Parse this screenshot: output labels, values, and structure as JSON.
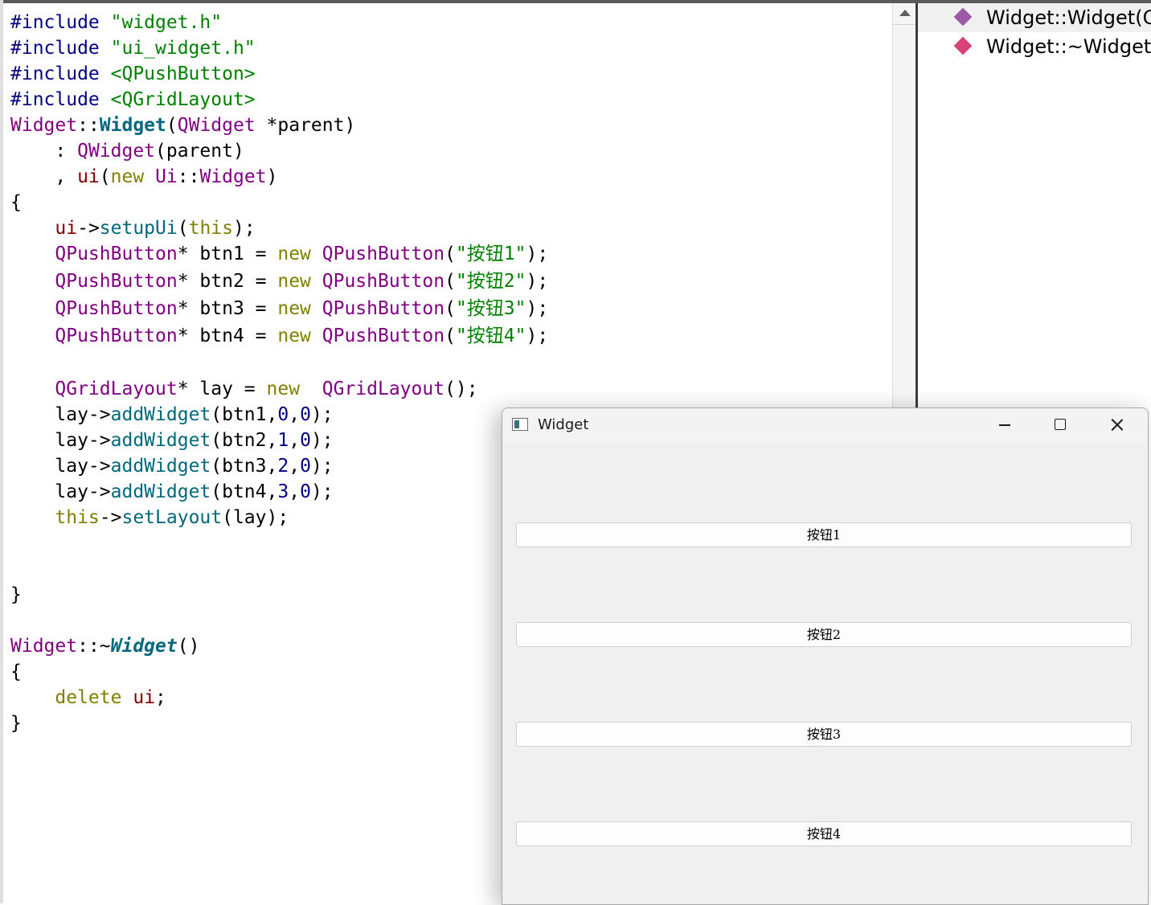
{
  "editor": {
    "lines": [
      [
        [
          "#include ",
          "t-pre"
        ],
        [
          "\"widget.h\"",
          "t-str"
        ]
      ],
      [
        [
          "#include ",
          "t-pre"
        ],
        [
          "\"ui_widget.h\"",
          "t-str"
        ]
      ],
      [
        [
          "#include ",
          "t-pre"
        ],
        [
          "<QPushButton>",
          "t-str"
        ]
      ],
      [
        [
          "#include ",
          "t-pre"
        ],
        [
          "<QGridLayout>",
          "t-str"
        ]
      ],
      [
        [
          "Widget",
          "t-type"
        ],
        [
          "::",
          ""
        ],
        [
          "Widget",
          "t-fn t-bold"
        ],
        [
          "(",
          ""
        ],
        [
          "QWidget",
          "t-type"
        ],
        [
          " *parent)",
          ""
        ]
      ],
      [
        [
          "    : ",
          ""
        ],
        [
          "QWidget",
          "t-type"
        ],
        [
          "(parent)",
          ""
        ]
      ],
      [
        [
          "    , ",
          ""
        ],
        [
          "ui",
          "t-var"
        ],
        [
          "(",
          ""
        ],
        [
          "new",
          "t-kw"
        ],
        [
          " ",
          ""
        ],
        [
          "Ui",
          "t-type"
        ],
        [
          "::",
          ""
        ],
        [
          "Widget",
          "t-type"
        ],
        [
          ")",
          ""
        ]
      ],
      [
        [
          "{",
          ""
        ]
      ],
      [
        [
          "    ",
          ""
        ],
        [
          "ui",
          "t-var"
        ],
        [
          "->",
          ""
        ],
        [
          "setupUi",
          "t-fn"
        ],
        [
          "(",
          ""
        ],
        [
          "this",
          "t-kw"
        ],
        [
          ");",
          ""
        ]
      ],
      [
        [
          "    ",
          ""
        ],
        [
          "QPushButton",
          "t-type"
        ],
        [
          "* btn1 = ",
          ""
        ],
        [
          "new",
          "t-kw"
        ],
        [
          " ",
          ""
        ],
        [
          "QPushButton",
          "t-type"
        ],
        [
          "(",
          ""
        ],
        [
          "\"按钮1\"",
          "t-str"
        ],
        [
          ");",
          ""
        ]
      ],
      [
        [
          "    ",
          ""
        ],
        [
          "QPushButton",
          "t-type"
        ],
        [
          "* btn2 = ",
          ""
        ],
        [
          "new",
          "t-kw"
        ],
        [
          " ",
          ""
        ],
        [
          "QPushButton",
          "t-type"
        ],
        [
          "(",
          ""
        ],
        [
          "\"按钮2\"",
          "t-str"
        ],
        [
          ");",
          ""
        ]
      ],
      [
        [
          "    ",
          ""
        ],
        [
          "QPushButton",
          "t-type"
        ],
        [
          "* btn3 = ",
          ""
        ],
        [
          "new",
          "t-kw"
        ],
        [
          " ",
          ""
        ],
        [
          "QPushButton",
          "t-type"
        ],
        [
          "(",
          ""
        ],
        [
          "\"按钮3\"",
          "t-str"
        ],
        [
          ");",
          ""
        ]
      ],
      [
        [
          "    ",
          ""
        ],
        [
          "QPushButton",
          "t-type"
        ],
        [
          "* btn4 = ",
          ""
        ],
        [
          "new",
          "t-kw"
        ],
        [
          " ",
          ""
        ],
        [
          "QPushButton",
          "t-type"
        ],
        [
          "(",
          ""
        ],
        [
          "\"按钮4\"",
          "t-str"
        ],
        [
          ");",
          ""
        ]
      ],
      [
        [
          "    ",
          ""
        ],
        [
          "QGridLayout",
          "t-type"
        ],
        [
          "* lay = ",
          ""
        ],
        [
          "new",
          "t-kw"
        ],
        [
          "  ",
          ""
        ],
        [
          "QGridLayout",
          "t-type"
        ],
        [
          "();",
          ""
        ]
      ],
      [
        [
          "    ",
          ""
        ],
        [
          "lay->",
          ""
        ],
        [
          "addWidget",
          "t-fn"
        ],
        [
          "(btn1,",
          ""
        ],
        [
          "0",
          "t-num"
        ],
        [
          ",",
          ""
        ],
        [
          "0",
          "t-num"
        ],
        [
          ");",
          ""
        ]
      ],
      [
        [
          "    ",
          ""
        ],
        [
          "lay->",
          ""
        ],
        [
          "addWidget",
          "t-fn"
        ],
        [
          "(btn2,",
          ""
        ],
        [
          "1",
          "t-num"
        ],
        [
          ",",
          ""
        ],
        [
          "0",
          "t-num"
        ],
        [
          ");",
          ""
        ]
      ],
      [
        [
          "    ",
          ""
        ],
        [
          "lay->",
          ""
        ],
        [
          "addWidget",
          "t-fn"
        ],
        [
          "(btn3,",
          ""
        ],
        [
          "2",
          "t-num"
        ],
        [
          ",",
          ""
        ],
        [
          "0",
          "t-num"
        ],
        [
          ");",
          ""
        ]
      ],
      [
        [
          "    ",
          ""
        ],
        [
          "lay->",
          ""
        ],
        [
          "addWidget",
          "t-fn"
        ],
        [
          "(btn4,",
          ""
        ],
        [
          "3",
          "t-num"
        ],
        [
          ",",
          ""
        ],
        [
          "0",
          "t-num"
        ],
        [
          ");",
          ""
        ]
      ],
      [
        [
          "    ",
          ""
        ],
        [
          "this",
          "t-kw"
        ],
        [
          "->",
          ""
        ],
        [
          "setLayout",
          "t-fn"
        ],
        [
          "(lay);",
          ""
        ]
      ],
      [
        [
          "}",
          ""
        ]
      ],
      [
        [
          "Widget",
          "t-type"
        ],
        [
          "::~",
          ""
        ],
        [
          "Widget",
          "t-fn t-bold t-italic"
        ],
        [
          "()",
          ""
        ]
      ],
      [
        [
          "{",
          ""
        ]
      ],
      [
        [
          "    ",
          ""
        ],
        [
          "delete",
          "t-kw"
        ],
        [
          " ",
          ""
        ],
        [
          "ui",
          "t-var"
        ],
        [
          ";",
          ""
        ]
      ],
      [
        [
          "}",
          ""
        ]
      ]
    ]
  },
  "outline": {
    "items": [
      {
        "label": "Widget::Widget(Q",
        "icon": "method-icon",
        "color": "#9b59a6",
        "selected": true
      },
      {
        "label": "Widget::~Widget(",
        "icon": "method-icon",
        "color": "#d9417a",
        "selected": false
      }
    ]
  },
  "app_window": {
    "title": "Widget",
    "buttons": [
      "按钮1",
      "按钮2",
      "按钮3",
      "按钮4"
    ]
  }
}
